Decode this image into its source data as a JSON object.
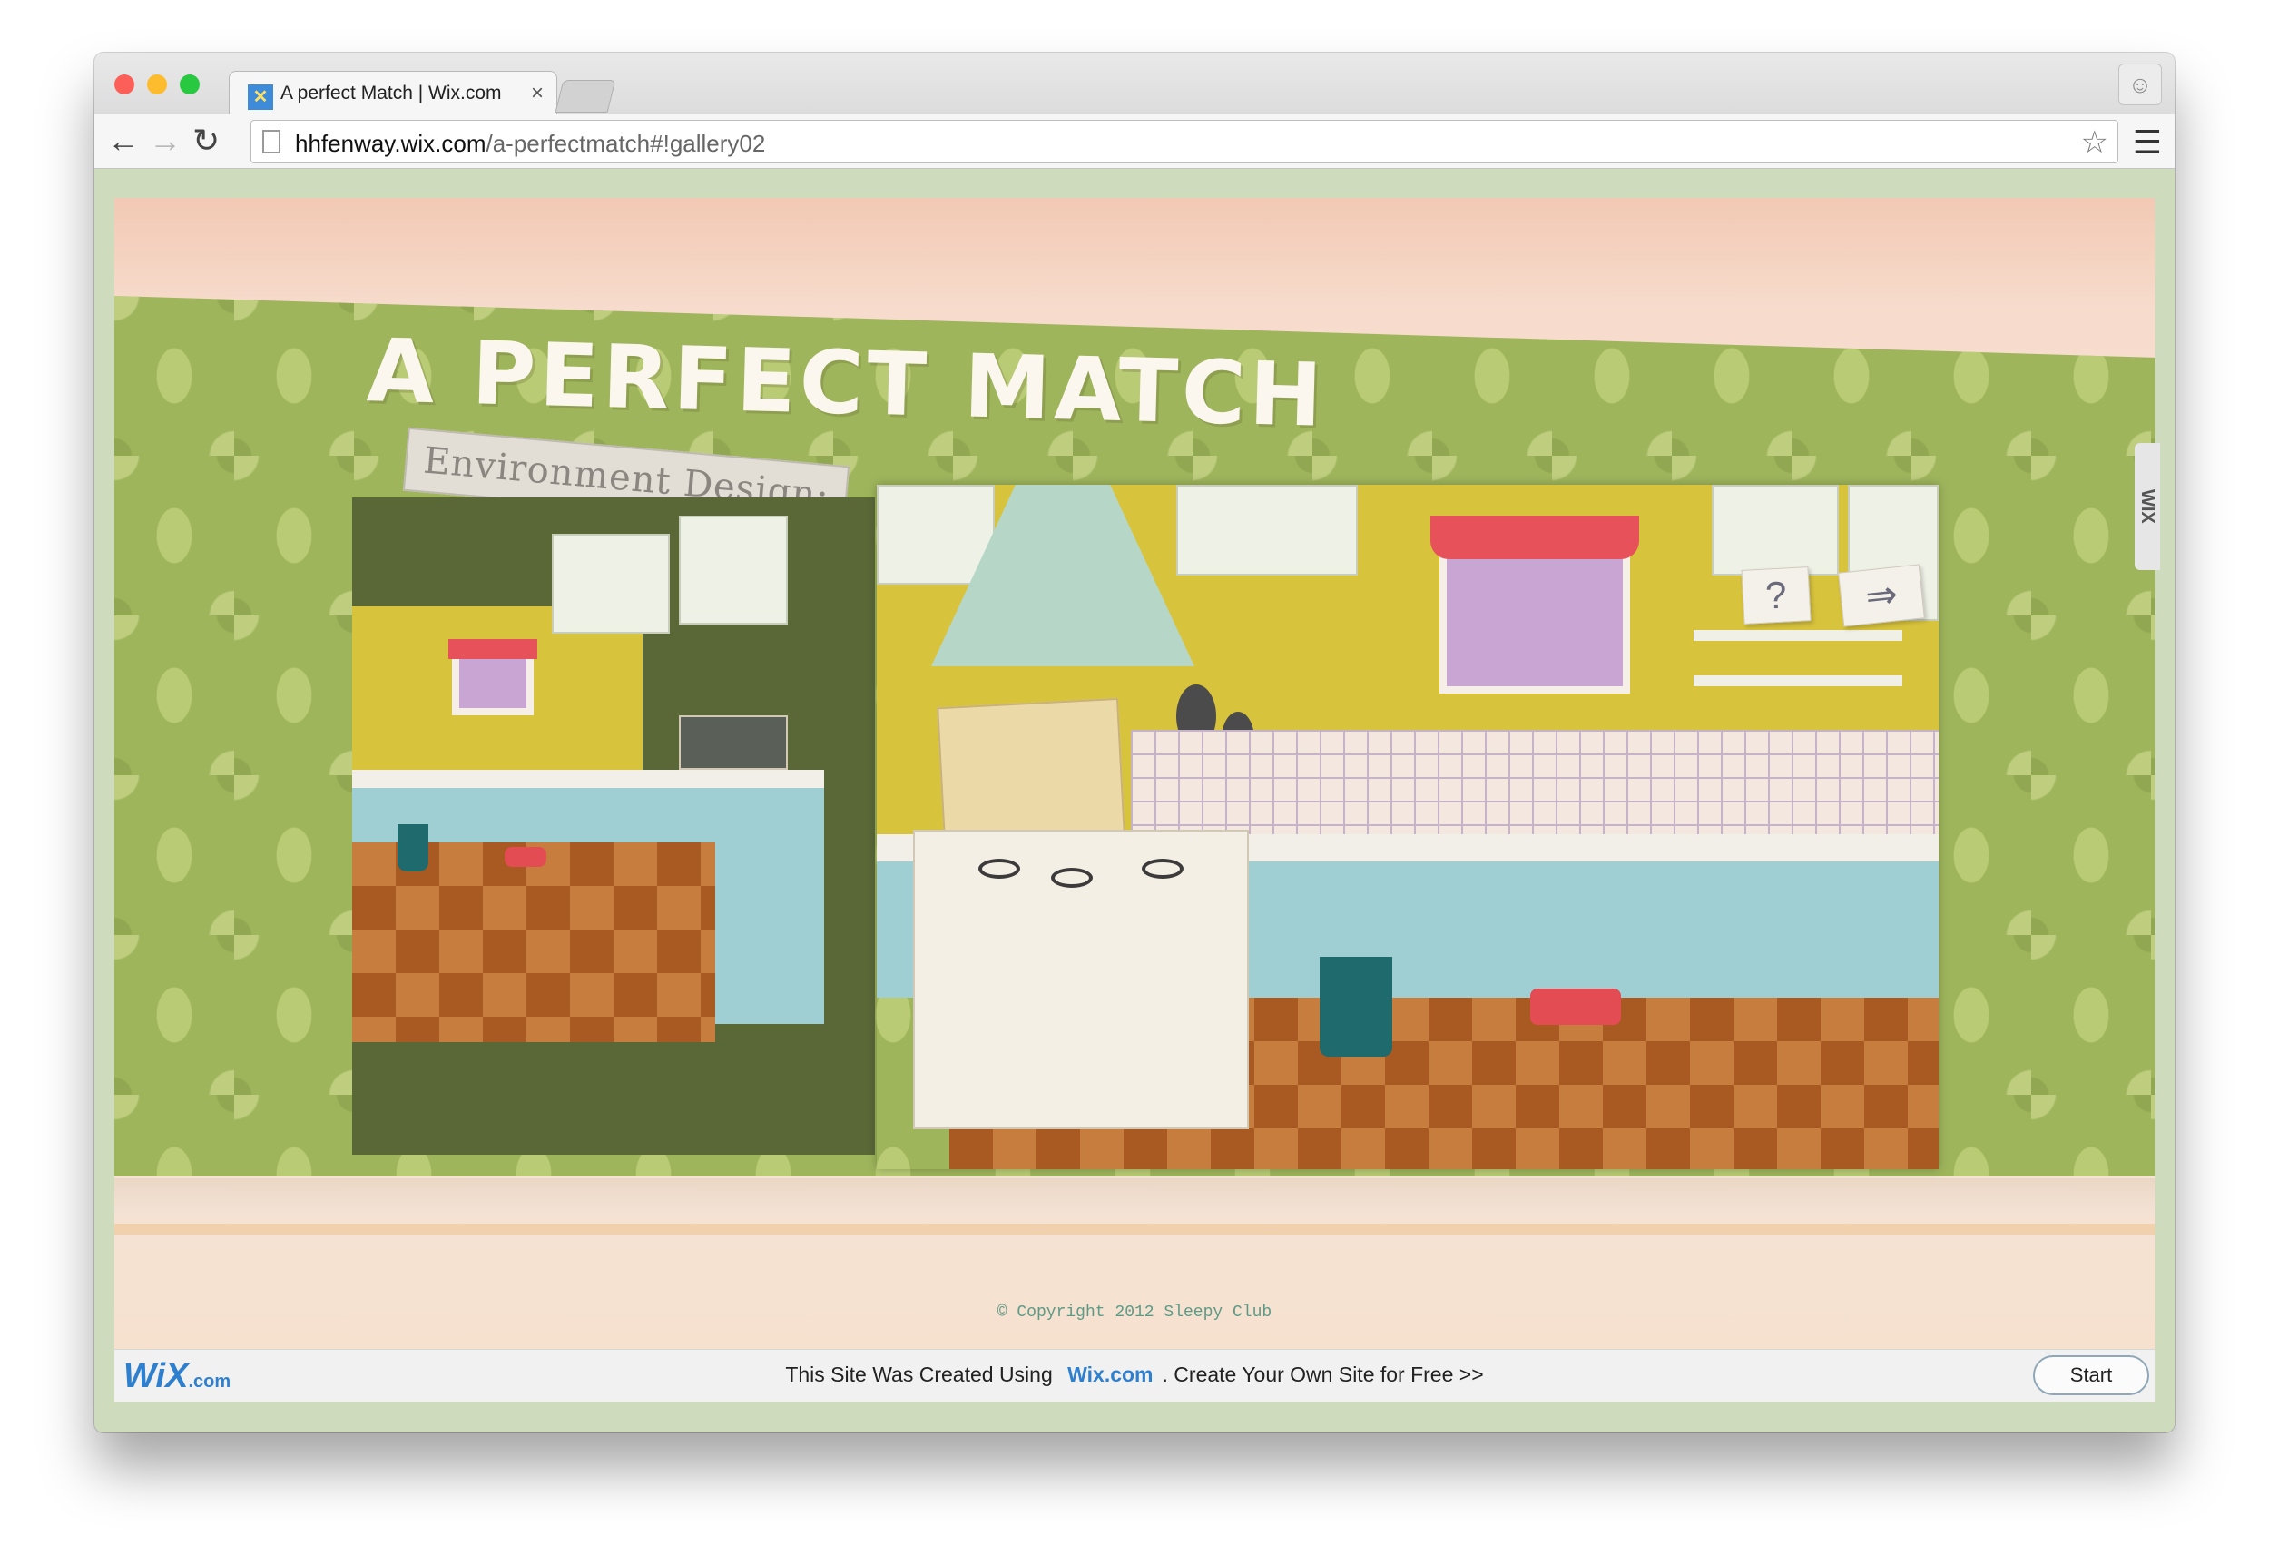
{
  "browser": {
    "tab_title": "A perfect Match | Wix.com",
    "tab_close": "×",
    "url_host": "hhfenway.wix.com",
    "url_path": "/a-perfectmatch#!gallery02",
    "icons": [
      "back-icon",
      "forward-icon",
      "reload-icon",
      "page-icon",
      "bookmark-star-icon",
      "menu-icon",
      "profile-icon"
    ]
  },
  "site": {
    "title": "A PERFECT MATCH",
    "subtitle": "Environment Design:",
    "nav_prev_icon": "?",
    "nav_next_icon": "⇒",
    "side_badge": "WIX",
    "copyright": "© Copyright 2012 Sleepy Club"
  },
  "wix_bar": {
    "logo": "WiX",
    "logo_suffix": ".com",
    "text_before": "This Site Was Created Using",
    "link": "Wix.com",
    "text_after": ". Create Your Own Site for Free >>",
    "start_label": "Start"
  },
  "colors": {
    "wallpaper": "#9fb55c",
    "wix_blue": "#2f7fcf",
    "kitchen_wall": "#d8c33c",
    "floor": "#c77d3e"
  }
}
